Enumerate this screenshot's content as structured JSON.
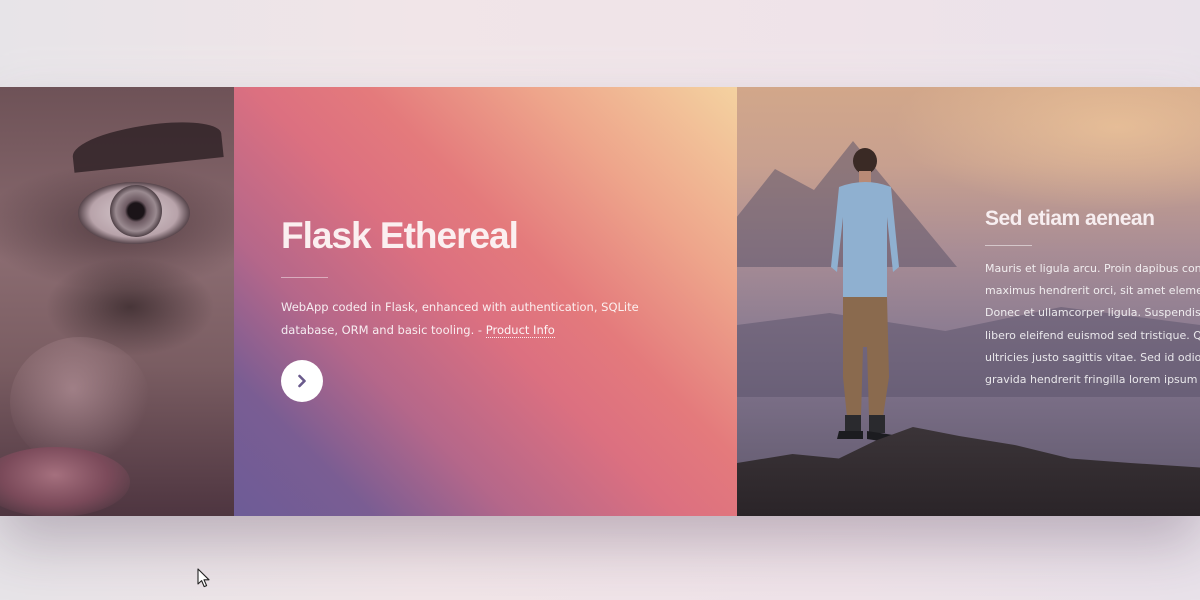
{
  "feature": {
    "title": "Flask Ethereal",
    "description": "WebApp coded in Flask, enhanced with authentication, SQLite database, ORM and basic tooling. - ",
    "link_label": "Product Info",
    "button_icon": "chevron-right-icon"
  },
  "scene": {
    "title": "Sed etiam aenean",
    "lines": [
      "Mauris et ligula arcu. Proin dapibus conv",
      "maximus hendrerit orci, sit amet elemen",
      "Donec et ullamcorper ligula. Suspendiss",
      "libero eleifend euismod sed tristique. Qu",
      "ultricies justo sagittis vitae. Sed id odio t",
      "gravida hendrerit fringilla lorem ipsum c"
    ]
  },
  "colors": {
    "gradient_start": "#f4d2a0",
    "gradient_mid": "#e47a7c",
    "gradient_end": "#6d5c97",
    "button_icon": "#6a5a8c"
  }
}
